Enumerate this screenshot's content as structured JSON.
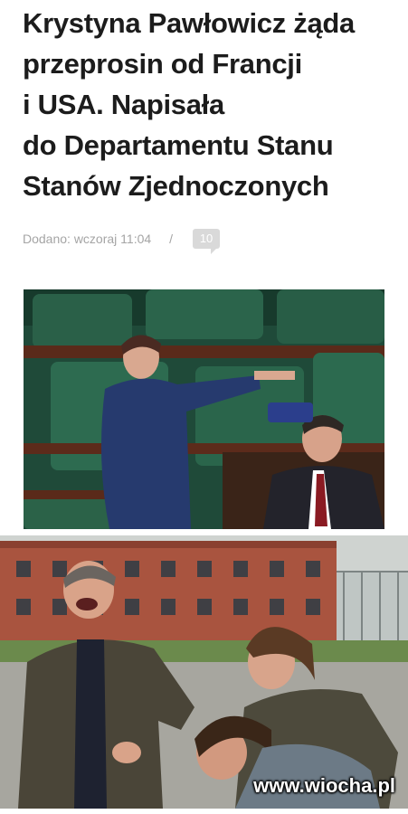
{
  "article": {
    "headline_lines": [
      "Krystyna Pawłowicz żąda",
      "przeprosin od Francji",
      "i USA. Napisała",
      "do Departamentu Stanu",
      "Stanów Zjednoczonych"
    ],
    "added_label": "Dodano: wczoraj 11:04",
    "separator": "/",
    "comment_count": "10"
  },
  "images": {
    "photo1_icon": "photo-parliament",
    "photo2_icon": "photo-laughing-men",
    "watermark": "www.wiocha.pl"
  }
}
